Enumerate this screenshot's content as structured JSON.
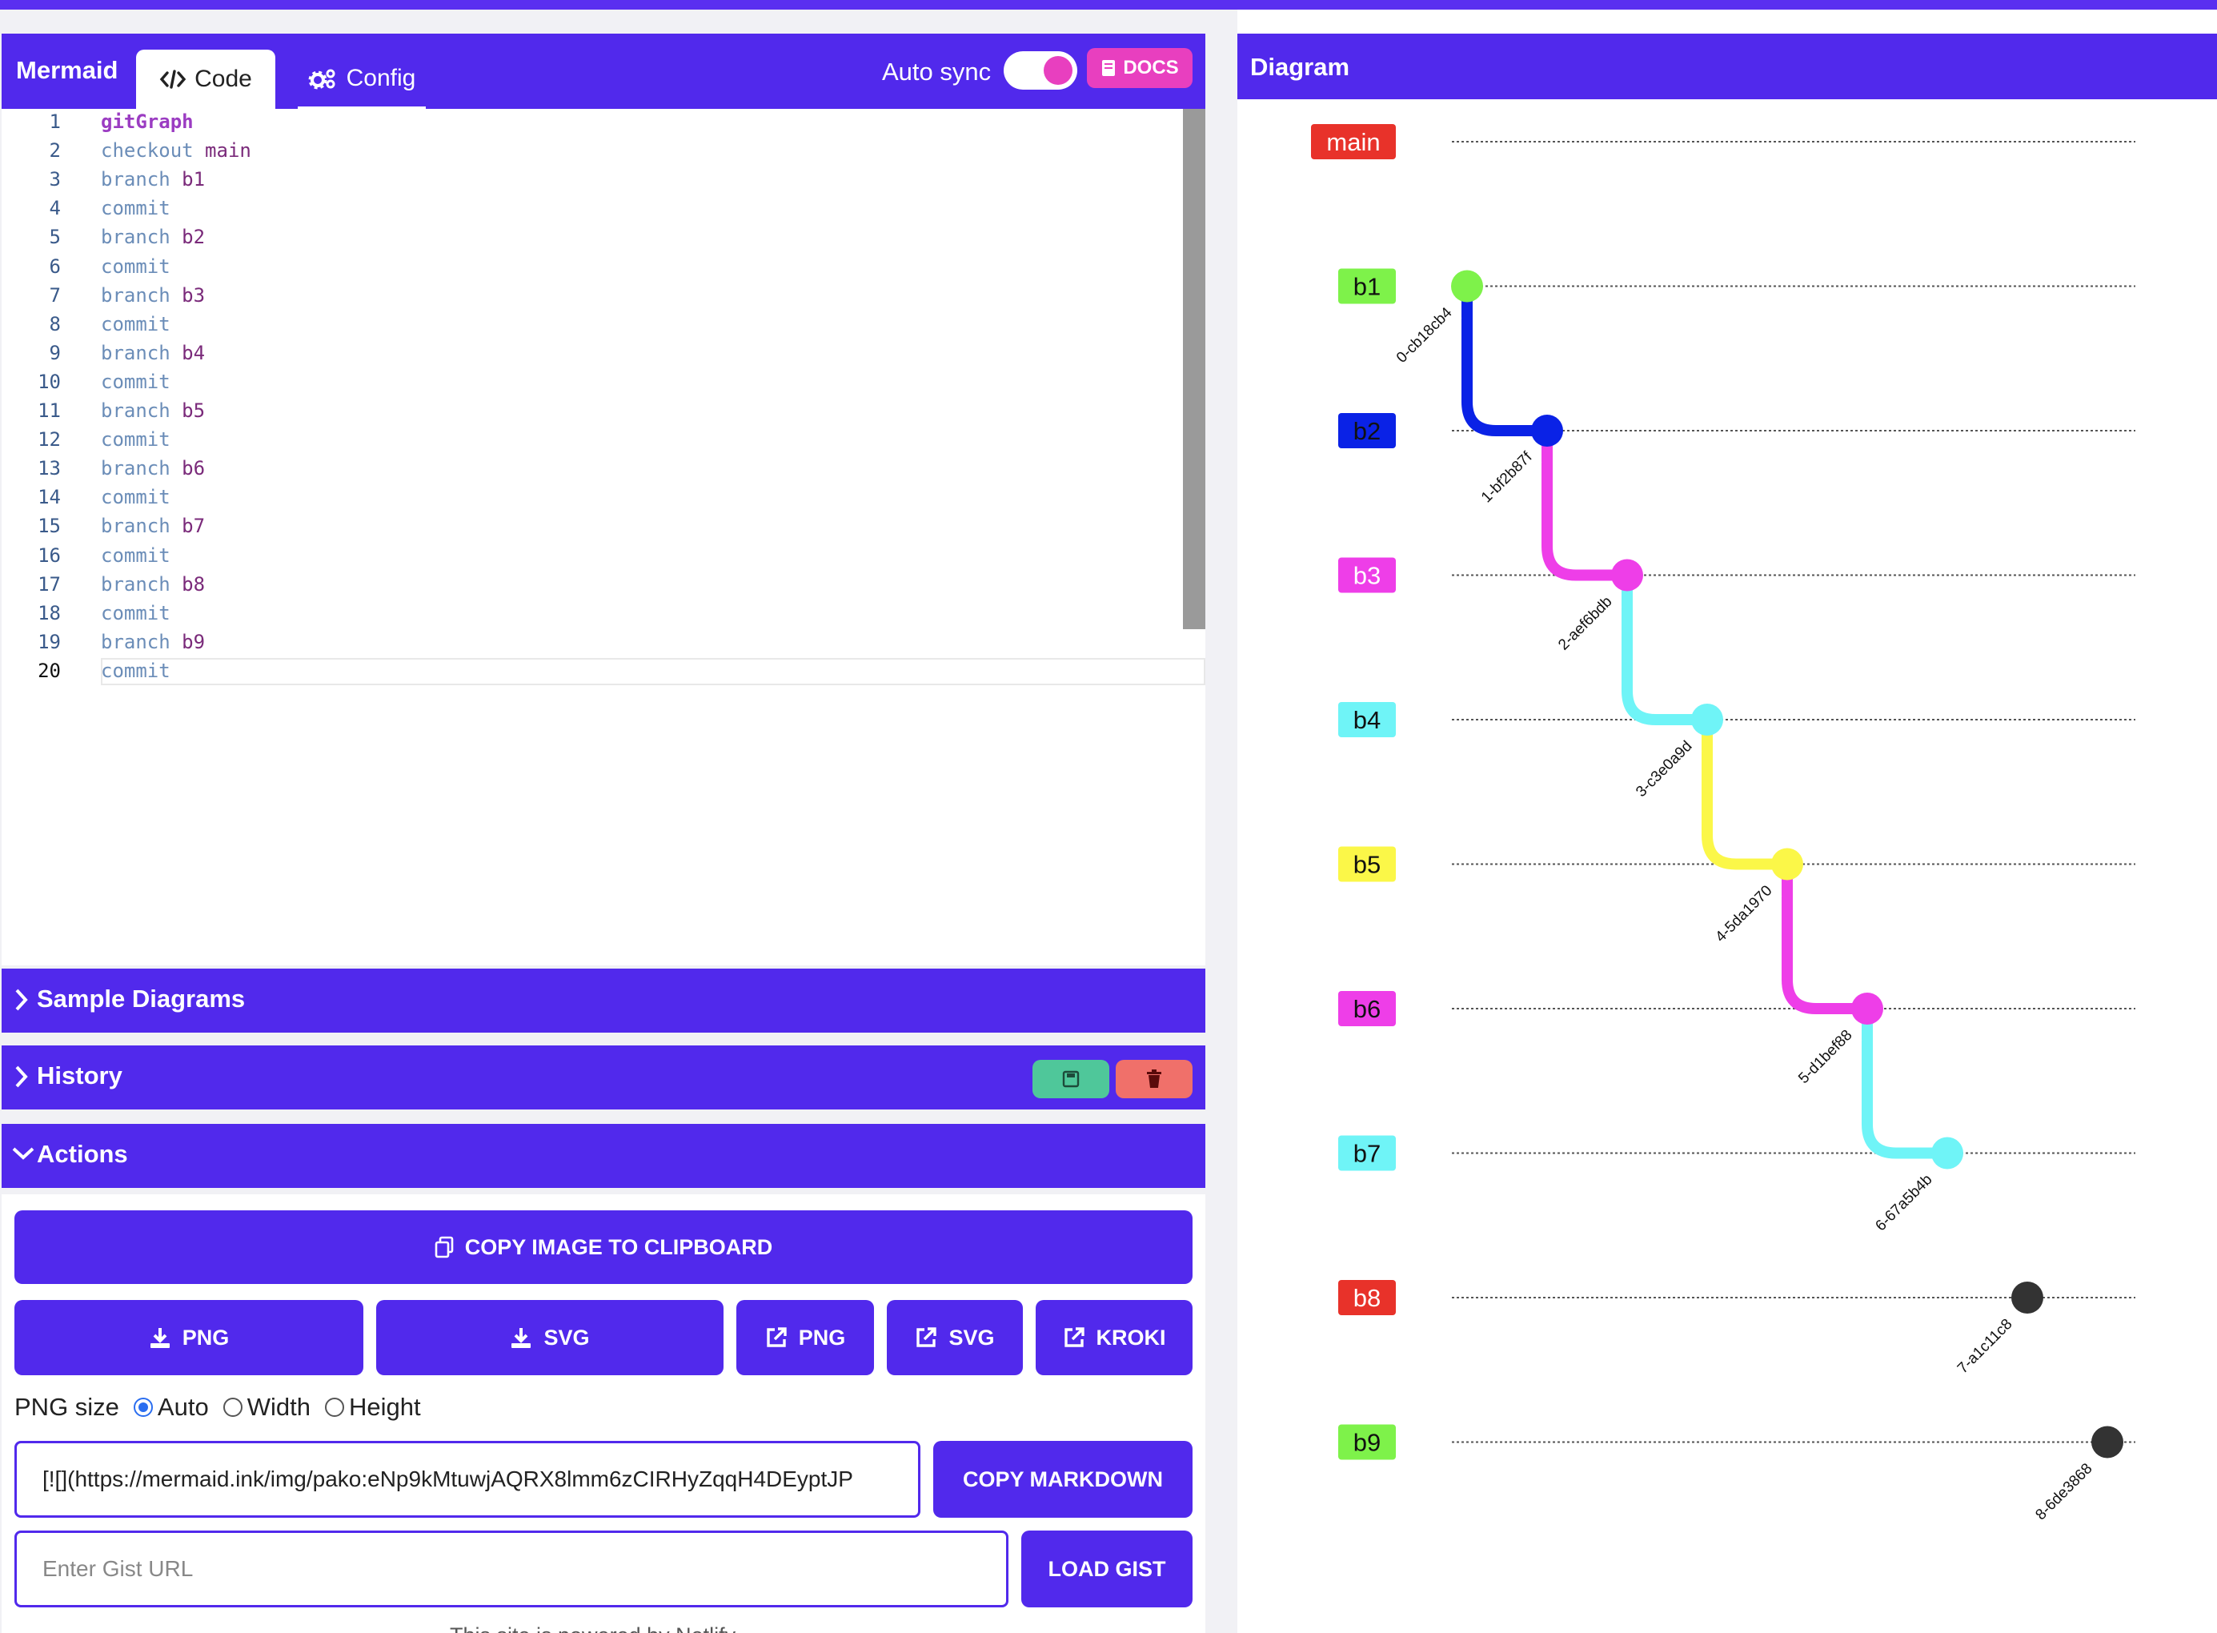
{
  "app": {
    "brand": "Mermaid",
    "tabs": [
      {
        "label": "Code",
        "active": true
      },
      {
        "label": "Config",
        "active": false
      }
    ],
    "auto_sync_label": "Auto sync",
    "auto_sync_on": true,
    "docs_label": "DOCS"
  },
  "editor": {
    "lines": [
      "gitGraph",
      "checkout main",
      "branch b1",
      "commit",
      "branch b2",
      "commit",
      "branch b3",
      "commit",
      "branch b4",
      "commit",
      "branch b5",
      "commit",
      "branch b6",
      "commit",
      "branch b7",
      "commit",
      "branch b8",
      "commit",
      "branch b9",
      "commit"
    ],
    "line_numbers": [
      "1",
      "2",
      "3",
      "4",
      "5",
      "6",
      "7",
      "8",
      "9",
      "10",
      "11",
      "12",
      "13",
      "14",
      "15",
      "16",
      "17",
      "18",
      "19",
      "20"
    ],
    "active_line": 20
  },
  "panels": {
    "sample_diagrams": "Sample Diagrams",
    "history": "History",
    "actions": "Actions"
  },
  "actions": {
    "copy_image": "COPY IMAGE TO CLIPBOARD",
    "download_png": "PNG",
    "download_svg": "SVG",
    "open_png": "PNG",
    "open_svg": "SVG",
    "kroki": "KROKI",
    "png_size_label": "PNG size",
    "png_size_options": [
      "Auto",
      "Width",
      "Height"
    ],
    "png_size_selected": "Auto",
    "markdown_value": "[![](https://mermaid.ink/img/pako:eNp9kMtuwjAQRX8lmm6zCIRHyZqqH4DEyptJP",
    "copy_markdown": "COPY MARKDOWN",
    "gist_placeholder": "Enter Gist URL",
    "load_gist": "LOAD GIST",
    "footer": "This site is powered by Netlify"
  },
  "diagram": {
    "title": "Diagram",
    "branches": [
      {
        "name": "main",
        "color": "#e8322a",
        "text_color": "#ffffff"
      },
      {
        "name": "b1",
        "color": "#7ef24a",
        "text_color": "#111111"
      },
      {
        "name": "b2",
        "color": "#0a22e6",
        "text_color": "#111111"
      },
      {
        "name": "b3",
        "color": "#ee3ee8",
        "text_color": "#ffffff"
      },
      {
        "name": "b4",
        "color": "#6ff4f7",
        "text_color": "#111111"
      },
      {
        "name": "b5",
        "color": "#fbf748",
        "text_color": "#111111"
      },
      {
        "name": "b6",
        "color": "#ee3ee8",
        "text_color": "#111111"
      },
      {
        "name": "b7",
        "color": "#6ff4f7",
        "text_color": "#111111"
      },
      {
        "name": "b8",
        "color": "#e8322a",
        "text_color": "#ffffff"
      },
      {
        "name": "b9",
        "color": "#7ef24a",
        "text_color": "#111111"
      }
    ],
    "commits": [
      {
        "id": "0-cb18cb4",
        "branch": "b1",
        "order": 0,
        "color": "#7ef24a"
      },
      {
        "id": "1-bf2b87f",
        "branch": "b2",
        "order": 1,
        "color": "#0a22e6"
      },
      {
        "id": "2-aef6bdb",
        "branch": "b3",
        "order": 2,
        "color": "#ee3ee8"
      },
      {
        "id": "3-c3e0a9d",
        "branch": "b4",
        "order": 3,
        "color": "#6ff4f7"
      },
      {
        "id": "4-5da1970",
        "branch": "b5",
        "order": 4,
        "color": "#fbf748"
      },
      {
        "id": "5-d1bef88",
        "branch": "b6",
        "order": 5,
        "color": "#ee3ee8"
      },
      {
        "id": "6-67a5b4b",
        "branch": "b7",
        "order": 6,
        "color": "#6ff4f7"
      },
      {
        "id": "7-a1c11c8",
        "branch": "b8",
        "order": 7,
        "color": "#333333"
      },
      {
        "id": "8-6de3868",
        "branch": "b9",
        "order": 8,
        "color": "#333333"
      }
    ]
  }
}
